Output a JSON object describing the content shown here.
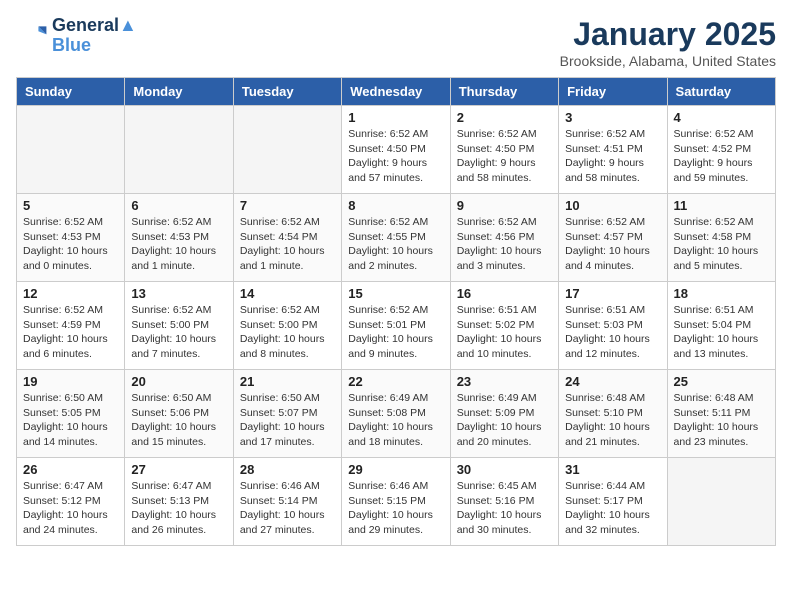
{
  "header": {
    "logo_line1": "General",
    "logo_line2": "Blue",
    "title": "January 2025",
    "subtitle": "Brookside, Alabama, United States"
  },
  "weekdays": [
    "Sunday",
    "Monday",
    "Tuesday",
    "Wednesday",
    "Thursday",
    "Friday",
    "Saturday"
  ],
  "weeks": [
    [
      {
        "day": "",
        "info": ""
      },
      {
        "day": "",
        "info": ""
      },
      {
        "day": "",
        "info": ""
      },
      {
        "day": "1",
        "info": "Sunrise: 6:52 AM\nSunset: 4:50 PM\nDaylight: 9 hours and 57 minutes."
      },
      {
        "day": "2",
        "info": "Sunrise: 6:52 AM\nSunset: 4:50 PM\nDaylight: 9 hours and 58 minutes."
      },
      {
        "day": "3",
        "info": "Sunrise: 6:52 AM\nSunset: 4:51 PM\nDaylight: 9 hours and 58 minutes."
      },
      {
        "day": "4",
        "info": "Sunrise: 6:52 AM\nSunset: 4:52 PM\nDaylight: 9 hours and 59 minutes."
      }
    ],
    [
      {
        "day": "5",
        "info": "Sunrise: 6:52 AM\nSunset: 4:53 PM\nDaylight: 10 hours and 0 minutes."
      },
      {
        "day": "6",
        "info": "Sunrise: 6:52 AM\nSunset: 4:53 PM\nDaylight: 10 hours and 1 minute."
      },
      {
        "day": "7",
        "info": "Sunrise: 6:52 AM\nSunset: 4:54 PM\nDaylight: 10 hours and 1 minute."
      },
      {
        "day": "8",
        "info": "Sunrise: 6:52 AM\nSunset: 4:55 PM\nDaylight: 10 hours and 2 minutes."
      },
      {
        "day": "9",
        "info": "Sunrise: 6:52 AM\nSunset: 4:56 PM\nDaylight: 10 hours and 3 minutes."
      },
      {
        "day": "10",
        "info": "Sunrise: 6:52 AM\nSunset: 4:57 PM\nDaylight: 10 hours and 4 minutes."
      },
      {
        "day": "11",
        "info": "Sunrise: 6:52 AM\nSunset: 4:58 PM\nDaylight: 10 hours and 5 minutes."
      }
    ],
    [
      {
        "day": "12",
        "info": "Sunrise: 6:52 AM\nSunset: 4:59 PM\nDaylight: 10 hours and 6 minutes."
      },
      {
        "day": "13",
        "info": "Sunrise: 6:52 AM\nSunset: 5:00 PM\nDaylight: 10 hours and 7 minutes."
      },
      {
        "day": "14",
        "info": "Sunrise: 6:52 AM\nSunset: 5:00 PM\nDaylight: 10 hours and 8 minutes."
      },
      {
        "day": "15",
        "info": "Sunrise: 6:52 AM\nSunset: 5:01 PM\nDaylight: 10 hours and 9 minutes."
      },
      {
        "day": "16",
        "info": "Sunrise: 6:51 AM\nSunset: 5:02 PM\nDaylight: 10 hours and 10 minutes."
      },
      {
        "day": "17",
        "info": "Sunrise: 6:51 AM\nSunset: 5:03 PM\nDaylight: 10 hours and 12 minutes."
      },
      {
        "day": "18",
        "info": "Sunrise: 6:51 AM\nSunset: 5:04 PM\nDaylight: 10 hours and 13 minutes."
      }
    ],
    [
      {
        "day": "19",
        "info": "Sunrise: 6:50 AM\nSunset: 5:05 PM\nDaylight: 10 hours and 14 minutes."
      },
      {
        "day": "20",
        "info": "Sunrise: 6:50 AM\nSunset: 5:06 PM\nDaylight: 10 hours and 15 minutes."
      },
      {
        "day": "21",
        "info": "Sunrise: 6:50 AM\nSunset: 5:07 PM\nDaylight: 10 hours and 17 minutes."
      },
      {
        "day": "22",
        "info": "Sunrise: 6:49 AM\nSunset: 5:08 PM\nDaylight: 10 hours and 18 minutes."
      },
      {
        "day": "23",
        "info": "Sunrise: 6:49 AM\nSunset: 5:09 PM\nDaylight: 10 hours and 20 minutes."
      },
      {
        "day": "24",
        "info": "Sunrise: 6:48 AM\nSunset: 5:10 PM\nDaylight: 10 hours and 21 minutes."
      },
      {
        "day": "25",
        "info": "Sunrise: 6:48 AM\nSunset: 5:11 PM\nDaylight: 10 hours and 23 minutes."
      }
    ],
    [
      {
        "day": "26",
        "info": "Sunrise: 6:47 AM\nSunset: 5:12 PM\nDaylight: 10 hours and 24 minutes."
      },
      {
        "day": "27",
        "info": "Sunrise: 6:47 AM\nSunset: 5:13 PM\nDaylight: 10 hours and 26 minutes."
      },
      {
        "day": "28",
        "info": "Sunrise: 6:46 AM\nSunset: 5:14 PM\nDaylight: 10 hours and 27 minutes."
      },
      {
        "day": "29",
        "info": "Sunrise: 6:46 AM\nSunset: 5:15 PM\nDaylight: 10 hours and 29 minutes."
      },
      {
        "day": "30",
        "info": "Sunrise: 6:45 AM\nSunset: 5:16 PM\nDaylight: 10 hours and 30 minutes."
      },
      {
        "day": "31",
        "info": "Sunrise: 6:44 AM\nSunset: 5:17 PM\nDaylight: 10 hours and 32 minutes."
      },
      {
        "day": "",
        "info": ""
      }
    ]
  ]
}
